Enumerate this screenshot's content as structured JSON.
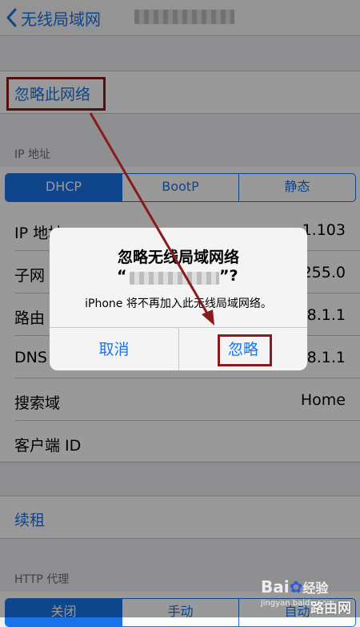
{
  "nav": {
    "back_label": "无线局域网"
  },
  "forget": {
    "label": "忽略此网络"
  },
  "ip_section": {
    "header": "IP 地址",
    "segments": [
      "DHCP",
      "BootP",
      "静态"
    ],
    "selected": "DHCP"
  },
  "rows": [
    {
      "label": "IP 地址",
      "value": "1.103"
    },
    {
      "label": "子网",
      "value": "255.0"
    },
    {
      "label": "路由",
      "value": "8.1.1"
    },
    {
      "label": "DNS",
      "value": "8.1.1"
    },
    {
      "label": "搜索域",
      "value": "Home"
    },
    {
      "label": "客户端 ID",
      "value": ""
    }
  ],
  "renew": {
    "label": "续租"
  },
  "http_proxy": {
    "header": "HTTP 代理",
    "segments": [
      "关闭",
      "手动",
      "自动"
    ],
    "selected": "关闭"
  },
  "dialog": {
    "title": "忽略无线局域网络",
    "quote_open": "“",
    "quote_close": "”?",
    "message": "iPhone 将不再加入此无线局域网络。",
    "cancel_label": "取消",
    "forget_label": "忽略"
  },
  "watermark": {
    "brand": "Bai",
    "brand2": "经验",
    "url": "jingyan.baidu.com",
    "corner": "路由网"
  },
  "colors": {
    "accent": "#1a73e8",
    "annotation": "#8b1a1a"
  }
}
